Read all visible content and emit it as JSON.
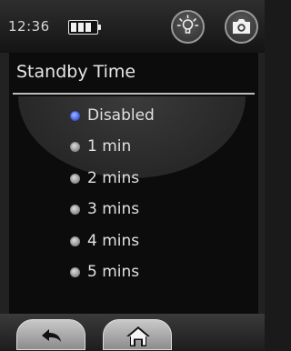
{
  "status": {
    "time": "12:36",
    "icons": [
      "battery-icon",
      "lightbulb-icon",
      "camera-icon"
    ]
  },
  "screen": {
    "title": "Standby Time",
    "options": [
      {
        "label": "Disabled",
        "selected": true
      },
      {
        "label": "1 min",
        "selected": false
      },
      {
        "label": "2 mins",
        "selected": false
      },
      {
        "label": "3 mins",
        "selected": false
      },
      {
        "label": "4 mins",
        "selected": false
      },
      {
        "label": "5 mins",
        "selected": false
      }
    ]
  },
  "nav": {
    "icons": [
      "back-arrow-icon",
      "home-icon"
    ]
  },
  "colors": {
    "selected_radio": "#2447d6",
    "panel_background": "#0c0c0c",
    "text": "#e0e0e0"
  }
}
